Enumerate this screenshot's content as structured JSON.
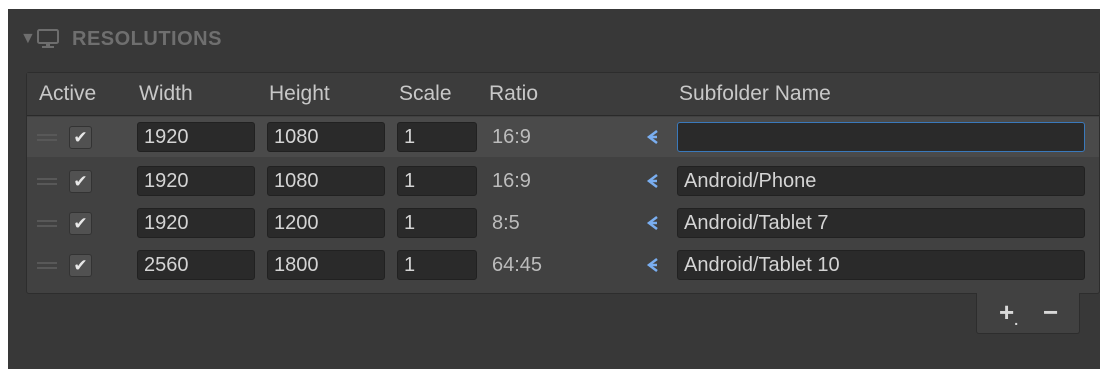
{
  "section": {
    "title": "RESOLUTIONS",
    "icon": "monitor-icon"
  },
  "columns": {
    "active": "Active",
    "width": "Width",
    "height": "Height",
    "scale": "Scale",
    "ratio": "Ratio",
    "subfolder": "Subfolder Name"
  },
  "rows": [
    {
      "active": true,
      "width": "1920",
      "height": "1080",
      "scale": "1",
      "ratio": "16:9",
      "subfolder": "",
      "selected": true
    },
    {
      "active": true,
      "width": "1920",
      "height": "1080",
      "scale": "1",
      "ratio": "16:9",
      "subfolder": "Android/Phone"
    },
    {
      "active": true,
      "width": "1920",
      "height": "1200",
      "scale": "1",
      "ratio": "8:5",
      "subfolder": "Android/Tablet 7"
    },
    {
      "active": true,
      "width": "2560",
      "height": "1800",
      "scale": "1",
      "ratio": "64:45",
      "subfolder": "Android/Tablet 10"
    }
  ],
  "footer": {
    "add_label": "+",
    "add_dropdown_mark": ".",
    "remove_label": "−"
  },
  "colors": {
    "accent_blue": "#3a79bb",
    "link_icon": "#7aaef0"
  }
}
